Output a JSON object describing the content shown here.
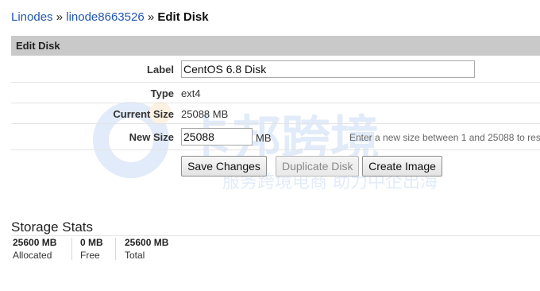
{
  "breadcrumb": {
    "linodes": "Linodes",
    "sep1": "»",
    "linode": "linode8663526",
    "sep2": "»",
    "current": "Edit Disk"
  },
  "section": {
    "title": "Edit Disk"
  },
  "form": {
    "label_label": "Label",
    "label_value": "CentOS 6.8 Disk",
    "type_label": "Type",
    "type_value": "ext4",
    "current_size_label": "Current Size",
    "current_size_value": "25088 MB",
    "new_size_label": "New Size",
    "new_size_value": "25088",
    "new_size_unit": "MB",
    "new_size_hint": "Enter a new size between 1 and 25088 to res"
  },
  "buttons": {
    "save": "Save Changes",
    "duplicate": "Duplicate Disk",
    "create_image": "Create Image"
  },
  "storage": {
    "title": "Storage Stats",
    "stats": [
      {
        "value": "25600 MB",
        "caption": "Allocated"
      },
      {
        "value": "0 MB",
        "caption": "Free"
      },
      {
        "value": "25600 MB",
        "caption": "Total"
      }
    ]
  },
  "watermark": {
    "line1": "卡邦跨境",
    "line2": "服务跨境电商 助力中企出海"
  },
  "colors": {
    "link": "#1f56b3",
    "section_bar": "#c9c9c9",
    "watermark": "#1e6fd9"
  }
}
